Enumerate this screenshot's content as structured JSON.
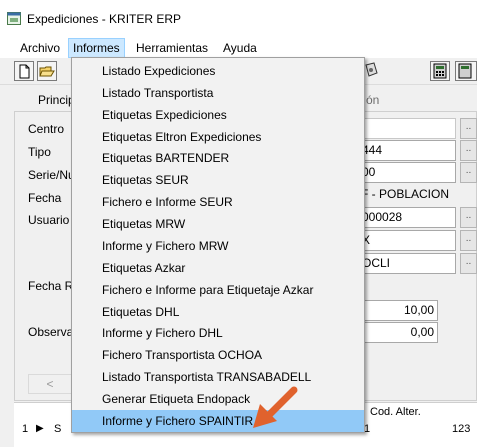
{
  "window": {
    "title": "Expediciones - KRITER ERP",
    "icon": "app-window-icon"
  },
  "menubar": {
    "items": [
      {
        "label": "Archivo",
        "open": false
      },
      {
        "label": "Informes",
        "open": true
      },
      {
        "label": "Herramientas",
        "open": false
      },
      {
        "label": "Ayuda",
        "open": false
      }
    ]
  },
  "toolbar": {
    "icons": [
      "new-document-icon",
      "open-folder-icon",
      "report-icon",
      "calculator-icon",
      "calculator-icon"
    ]
  },
  "tabs": {
    "first_partial": "Princip",
    "other_partial": "ón"
  },
  "form": {
    "labels": {
      "centro": "Centro",
      "tipo": "Tipo",
      "serie": "Serie/Nu",
      "fecha": "Fecha",
      "usuario": "Usuario",
      "fecha_r": "Fecha R",
      "observa": "Observa"
    },
    "values": {
      "tipo": "444",
      "serie": "00",
      "fecha": "F - POBLACION",
      "usuario": "000028",
      "extra1": "X",
      "extra2": "OCLI",
      "amount1": "10,00",
      "amount2": "0,00"
    },
    "scroll_left": "<"
  },
  "grid": {
    "header": "Cod. Alter.",
    "row1_num": "1",
    "row1_arrow": "▶",
    "row1_partial": "S",
    "row1_mid": "1",
    "row1_right": "123"
  },
  "informes_menu": {
    "items": [
      "Listado Expediciones",
      "Listado Transportista",
      "Etiquetas Expediciones",
      "Etiquetas Eltron Expediciones",
      "Etiquetas BARTENDER",
      "Etiquetas SEUR",
      "Fichero e Informe SEUR",
      "Etiquetas MRW",
      "Informe y Fichero MRW",
      "Etiquetas Azkar",
      "Fichero e Informe para Etiquetaje Azkar",
      "Etiquetas DHL",
      "Informe y Fichero DHL",
      "Fichero Transportista OCHOA",
      "Listado Transportista TRANSABADELL",
      "Generar Etiqueta Endopack",
      "Informe y Fichero SPAINTIR"
    ],
    "highlighted": "Informe y Fichero SPAINTIR"
  },
  "annotation": {
    "icon": "pointer-arrow-icon",
    "color": "#e0622d"
  }
}
